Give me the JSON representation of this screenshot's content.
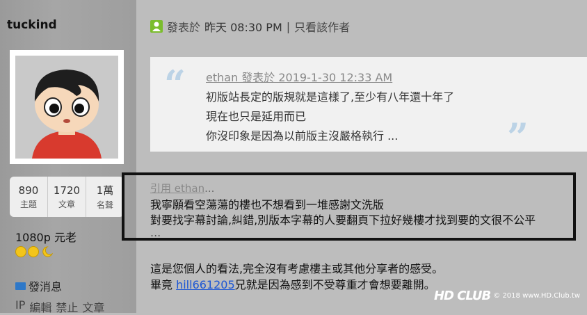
{
  "sidebar": {
    "username": "tuckind",
    "stats": [
      {
        "value": "890",
        "label": "主題"
      },
      {
        "value": "1720",
        "label": "文章"
      },
      {
        "value": "1萬",
        "label": "名聲"
      }
    ],
    "rank": "1080p 元老",
    "send_message": "發消息",
    "admin_links": [
      "IP",
      "編輯",
      "禁止",
      "文章"
    ]
  },
  "post": {
    "posted_label": "發表於",
    "posted_time": "昨天 08:30 PM",
    "separator": "|",
    "author_only": "只看該作者",
    "quote": {
      "author_line": "ethan 發表於 2019-1-30 12:33 AM",
      "lines": [
        "初版站長定的版規就是這樣了,至少有八年還十年了",
        "現在也只是延用而已",
        "你沒印象是因為以前版主沒嚴格執行 ..."
      ]
    },
    "cite_prefix": "引用",
    "cite_user": "ethan",
    "cite_suffix": "...",
    "reply_lines": [
      "我寧願看空蕩蕩的樓也不想看到一堆感謝文洗版",
      "對要找字幕討論,糾錯,別版本字幕的人要翻頁下拉好幾樓才找到要的文很不公平",
      "..."
    ],
    "comment_line1": "這是您個人的看法,完全沒有考慮樓主或其他分享者的感受。",
    "comment_line2_prefix": "畢竟 ",
    "comment_line2_link": "hill661205",
    "comment_line2_suffix": "兄就是因為感到不受尊重才會想要離開。"
  },
  "watermark": {
    "logo": "HD CLUB",
    "text": "© 2018 www.HD.Club.tw"
  }
}
